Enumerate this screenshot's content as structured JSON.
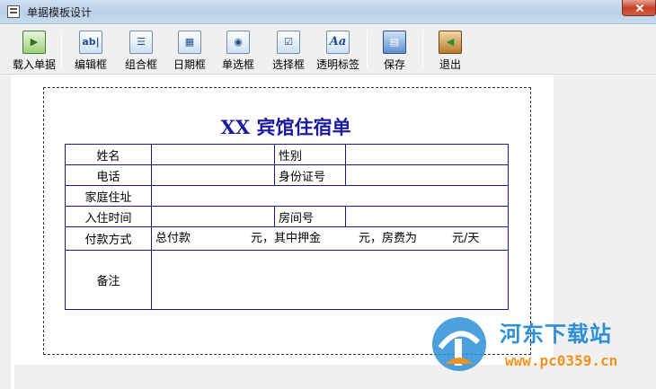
{
  "window": {
    "title": "单据模板设计"
  },
  "toolbar": {
    "buttons": [
      {
        "label": "载入单据",
        "icon": "load-form-icon"
      },
      {
        "label": "编辑框",
        "icon": "edit-box-icon"
      },
      {
        "label": "组合框",
        "icon": "combo-box-icon"
      },
      {
        "label": "日期框",
        "icon": "date-box-icon"
      },
      {
        "label": "单选框",
        "icon": "radio-box-icon"
      },
      {
        "label": "选择框",
        "icon": "checkbox-icon"
      },
      {
        "label": "透明标签",
        "icon": "transparent-label-icon"
      },
      {
        "label": "保存",
        "icon": "save-icon"
      },
      {
        "label": "退出",
        "icon": "exit-icon"
      }
    ],
    "icon_glyphs": {
      "edit": "ab|",
      "label": "Aa"
    }
  },
  "form": {
    "title": "XX 宾馆住宿单",
    "rows": {
      "name_label": "姓名",
      "gender_label": "性别",
      "phone_label": "电话",
      "id_label": "身份证号",
      "address_label": "家庭住址",
      "checkin_label": "入住时间",
      "room_label": "房间号",
      "payment_label": "付款方式",
      "payment_total": "总付款",
      "payment_mid": "元，其中押金",
      "payment_fee": "元，房费为",
      "payment_unit": "元/天",
      "remark_label": "备注"
    }
  },
  "watermark": {
    "name": "河东下载站",
    "url": "www.pc0359.cn"
  },
  "colors": {
    "form_border": "#1a1a8a",
    "form_title": "#1b1ba0",
    "wm_blue": "#2d8fd6",
    "wm_orange": "#f0921e"
  }
}
